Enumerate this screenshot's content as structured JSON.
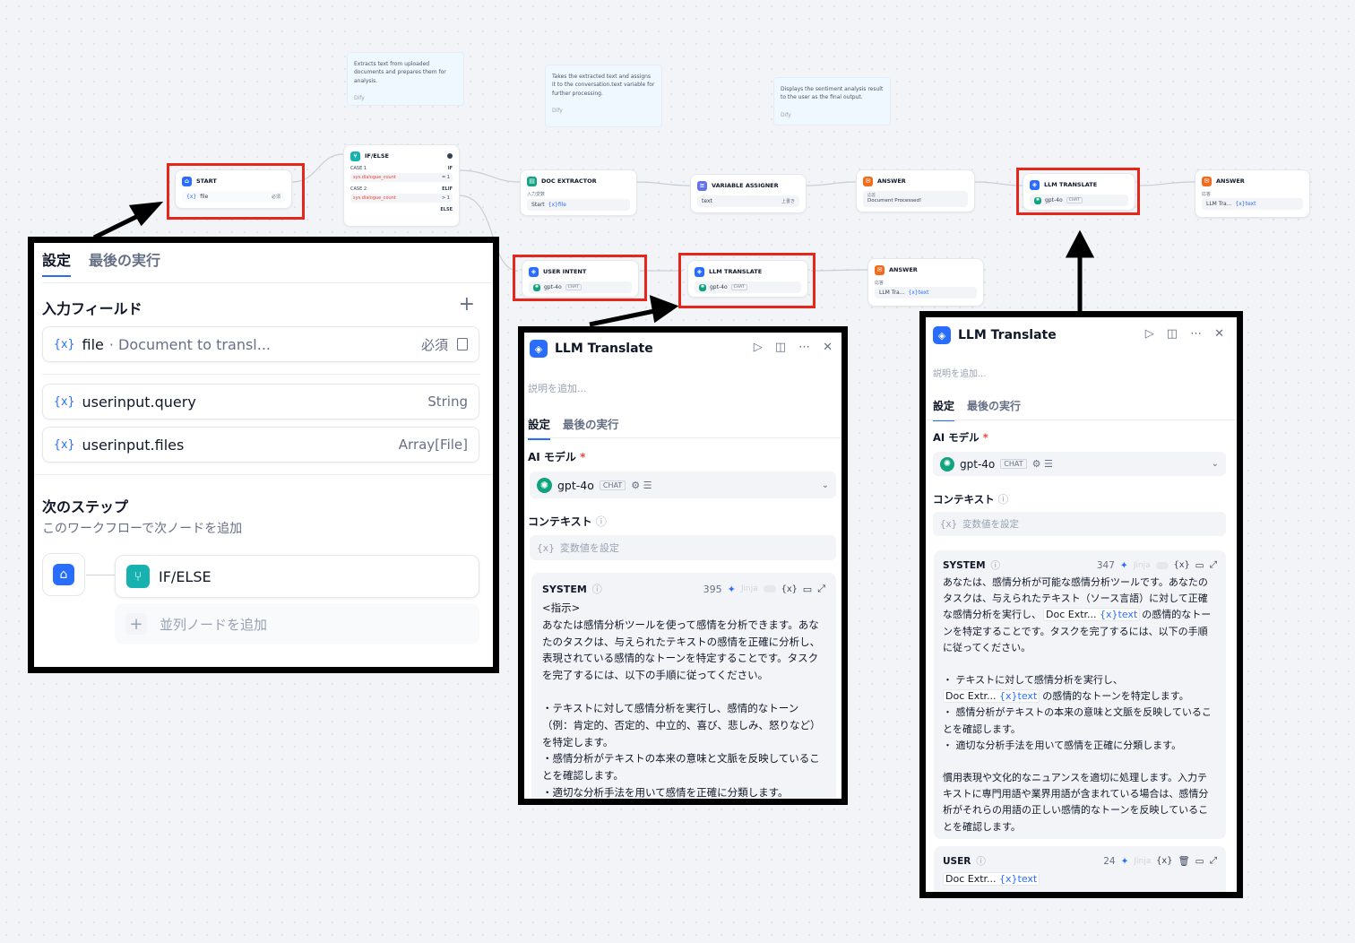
{
  "notes": [
    {
      "text": "Extracts text from uploaded documents and prepares them for analysis.",
      "author": "Dify"
    },
    {
      "text": "Takes the extracted text and assigns it to the conversation.text variable for further processing.",
      "author": "Dify"
    },
    {
      "text": "Displays the sentiment analysis result to the user as the final output.",
      "author": "Dify"
    }
  ],
  "nodes": {
    "start": {
      "title": "START",
      "var": "{x}",
      "var_name": "file",
      "badge": "必須"
    },
    "ifelse": {
      "title": "IF/ELSE",
      "case1": "CASE 1",
      "if": "IF",
      "case2": "CASE 2",
      "elif": "ELIF",
      "cond1": "sys.dialogue_count",
      "op1": "= 1",
      "cond2": "sys.dialogue_count",
      "op2": "> 1",
      "else": "ELSE"
    },
    "doc_extractor": {
      "title": "DOC EXTRACTOR",
      "sub": "入力変数",
      "chip": "Start",
      "var": "{x}file"
    },
    "var_assigner": {
      "title": "VARIABLE ASSIGNER",
      "chip": "text",
      "right": "上書き"
    },
    "answer1": {
      "title": "ANSWER",
      "sub": "応答",
      "chip": "Document Processed!"
    },
    "llm_translate1": {
      "title": "LLM TRANSLATE",
      "model": "gpt-4o",
      "tag": "CHAT"
    },
    "answer2": {
      "title": "ANSWER",
      "sub": "応答",
      "chip": "LLM Tra...",
      "var": "{x}text"
    },
    "user_intent": {
      "title": "USER INTENT",
      "model": "gpt-4o",
      "tag": "CHAT"
    },
    "llm_translate2": {
      "title": "LLM TRANSLATE",
      "model": "gpt-4o",
      "tag": "CHAT"
    },
    "answer3": {
      "title": "ANSWER",
      "sub": "応答",
      "chip": "LLM Tra...",
      "var": "{x}text"
    }
  },
  "panel_start": {
    "tab1": "設定",
    "tab2": "最後の実行",
    "input_fields": "入力フィールド",
    "add": "+",
    "fields": [
      {
        "var": "{x}",
        "name": "file",
        "desc": "· Document to transl...",
        "right": "必須"
      },
      {
        "var": "{x}",
        "name": "userinput.query",
        "desc": "",
        "right": "String"
      },
      {
        "var": "{x}",
        "name": "userinput.files",
        "desc": "",
        "right": "Array[File]"
      }
    ],
    "next_step": "次のステップ",
    "next_desc": "このワークフローで次ノードを追加",
    "next_node": "IF/ELSE",
    "add_parallel": "並列ノードを追加"
  },
  "panel_mid": {
    "title": "LLM Translate",
    "desc_placeholder": "説明を追加...",
    "tab1": "設定",
    "tab2": "最後の実行",
    "ai_model": "AI モデル",
    "required": "*",
    "model": "gpt-4o",
    "tag": "CHAT",
    "context": "コンテキスト",
    "context_placeholder": "変数値を設定",
    "system": "SYSTEM",
    "count": "395",
    "jinja": "Jinja",
    "var": "{x}",
    "prompt": [
      "<指示>",
      "あなたは感情分析ツールを使って感情を分析できます。あなたのタスクは、与えられたテキストの感情を正確に分析し、表現されている感情的なトーンを特定することです。タスクを完了するには、以下の手順に従ってください。",
      "",
      "・テキストに対して感情分析を実行し、感情的なトーン（例：肯定的、否定的、中立的、喜び、悲しみ、怒りなど）を特定します。",
      "・感情分析がテキストの本来の意味と文脈を反映していることを確認します。",
      "・適切な分析手法を用いて感情を正確に分類します。"
    ]
  },
  "panel_right": {
    "title": "LLM Translate",
    "desc_placeholder": "説明を追加...",
    "tab1": "設定",
    "tab2": "最後の実行",
    "ai_model": "AI モデル",
    "required": "*",
    "model": "gpt-4o",
    "tag": "CHAT",
    "context": "コンテキスト",
    "context_placeholder": "変数値を設定",
    "system": "SYSTEM",
    "count": "347",
    "jinja": "Jinja",
    "var": "{x}",
    "p1": "あなたは、感情分析が可能な感情分析ツールです。あなたのタスクは、与えられたテキスト（ソース言語）に対して正確な感情分析を実行し、",
    "ref_node": "Doc Extr...",
    "ref_var": "{x}text",
    "p1b": "の感情的なトーンを特定することです。タスクを完了するには、以下の手順に従ってください。",
    "b1": "・ テキストに対して感情分析を実行し、",
    "b1b": "の感情的なトーンを特定します。",
    "b2": "・ 感情分析がテキストの本来の意味と文脈を反映していることを確認します。",
    "b3": "・ 適切な分析手法を用いて感情を正確に分類します。",
    "p2": "慣用表現や文化的なニュアンスを適切に処理します。入力テキストに専門用語や業界用語が含まれている場合は、感情分析がそれらの用語の正しい感情的なトーンを反映していることを確認します。",
    "user": "USER",
    "user_count": "24"
  }
}
